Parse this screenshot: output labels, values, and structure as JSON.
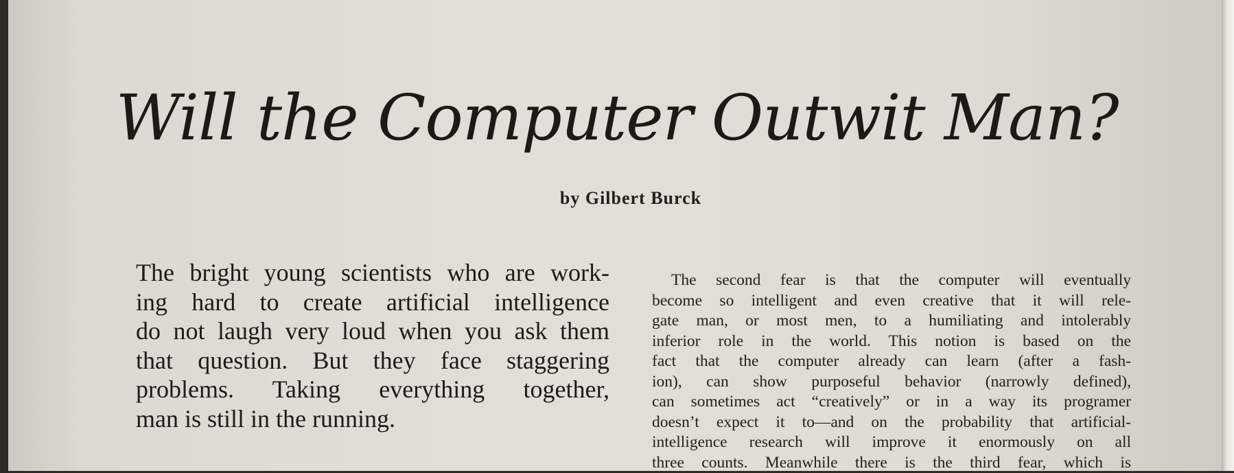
{
  "article": {
    "title": "Will the Computer Outwit Man?",
    "byline": "by Gilbert Burck",
    "lead_lines": [
      "The bright young scientists who are work-",
      "ing hard to create artificial intelligence",
      "do not laugh very loud when you ask them",
      "that question. But they face staggering",
      "problems. Taking everything together,",
      "man is still in the running."
    ],
    "body_lines": [
      "The second fear is that the computer will eventually",
      "become so intelligent and even creative that it will rele-",
      "gate man, or most men, to a humiliating and intolerably",
      "inferior role in the world. This notion is based on the",
      "fact that the computer already can learn (after a fash-",
      "ion), can show purposeful behavior (narrowly defined),",
      "can sometimes act “creatively” or in a way its programer",
      "doesn’t expect it to—and on the probability that artificial-",
      "intelligence research will improve it enormously on all",
      "three counts. Meanwhile there is the third fear, which is"
    ]
  }
}
